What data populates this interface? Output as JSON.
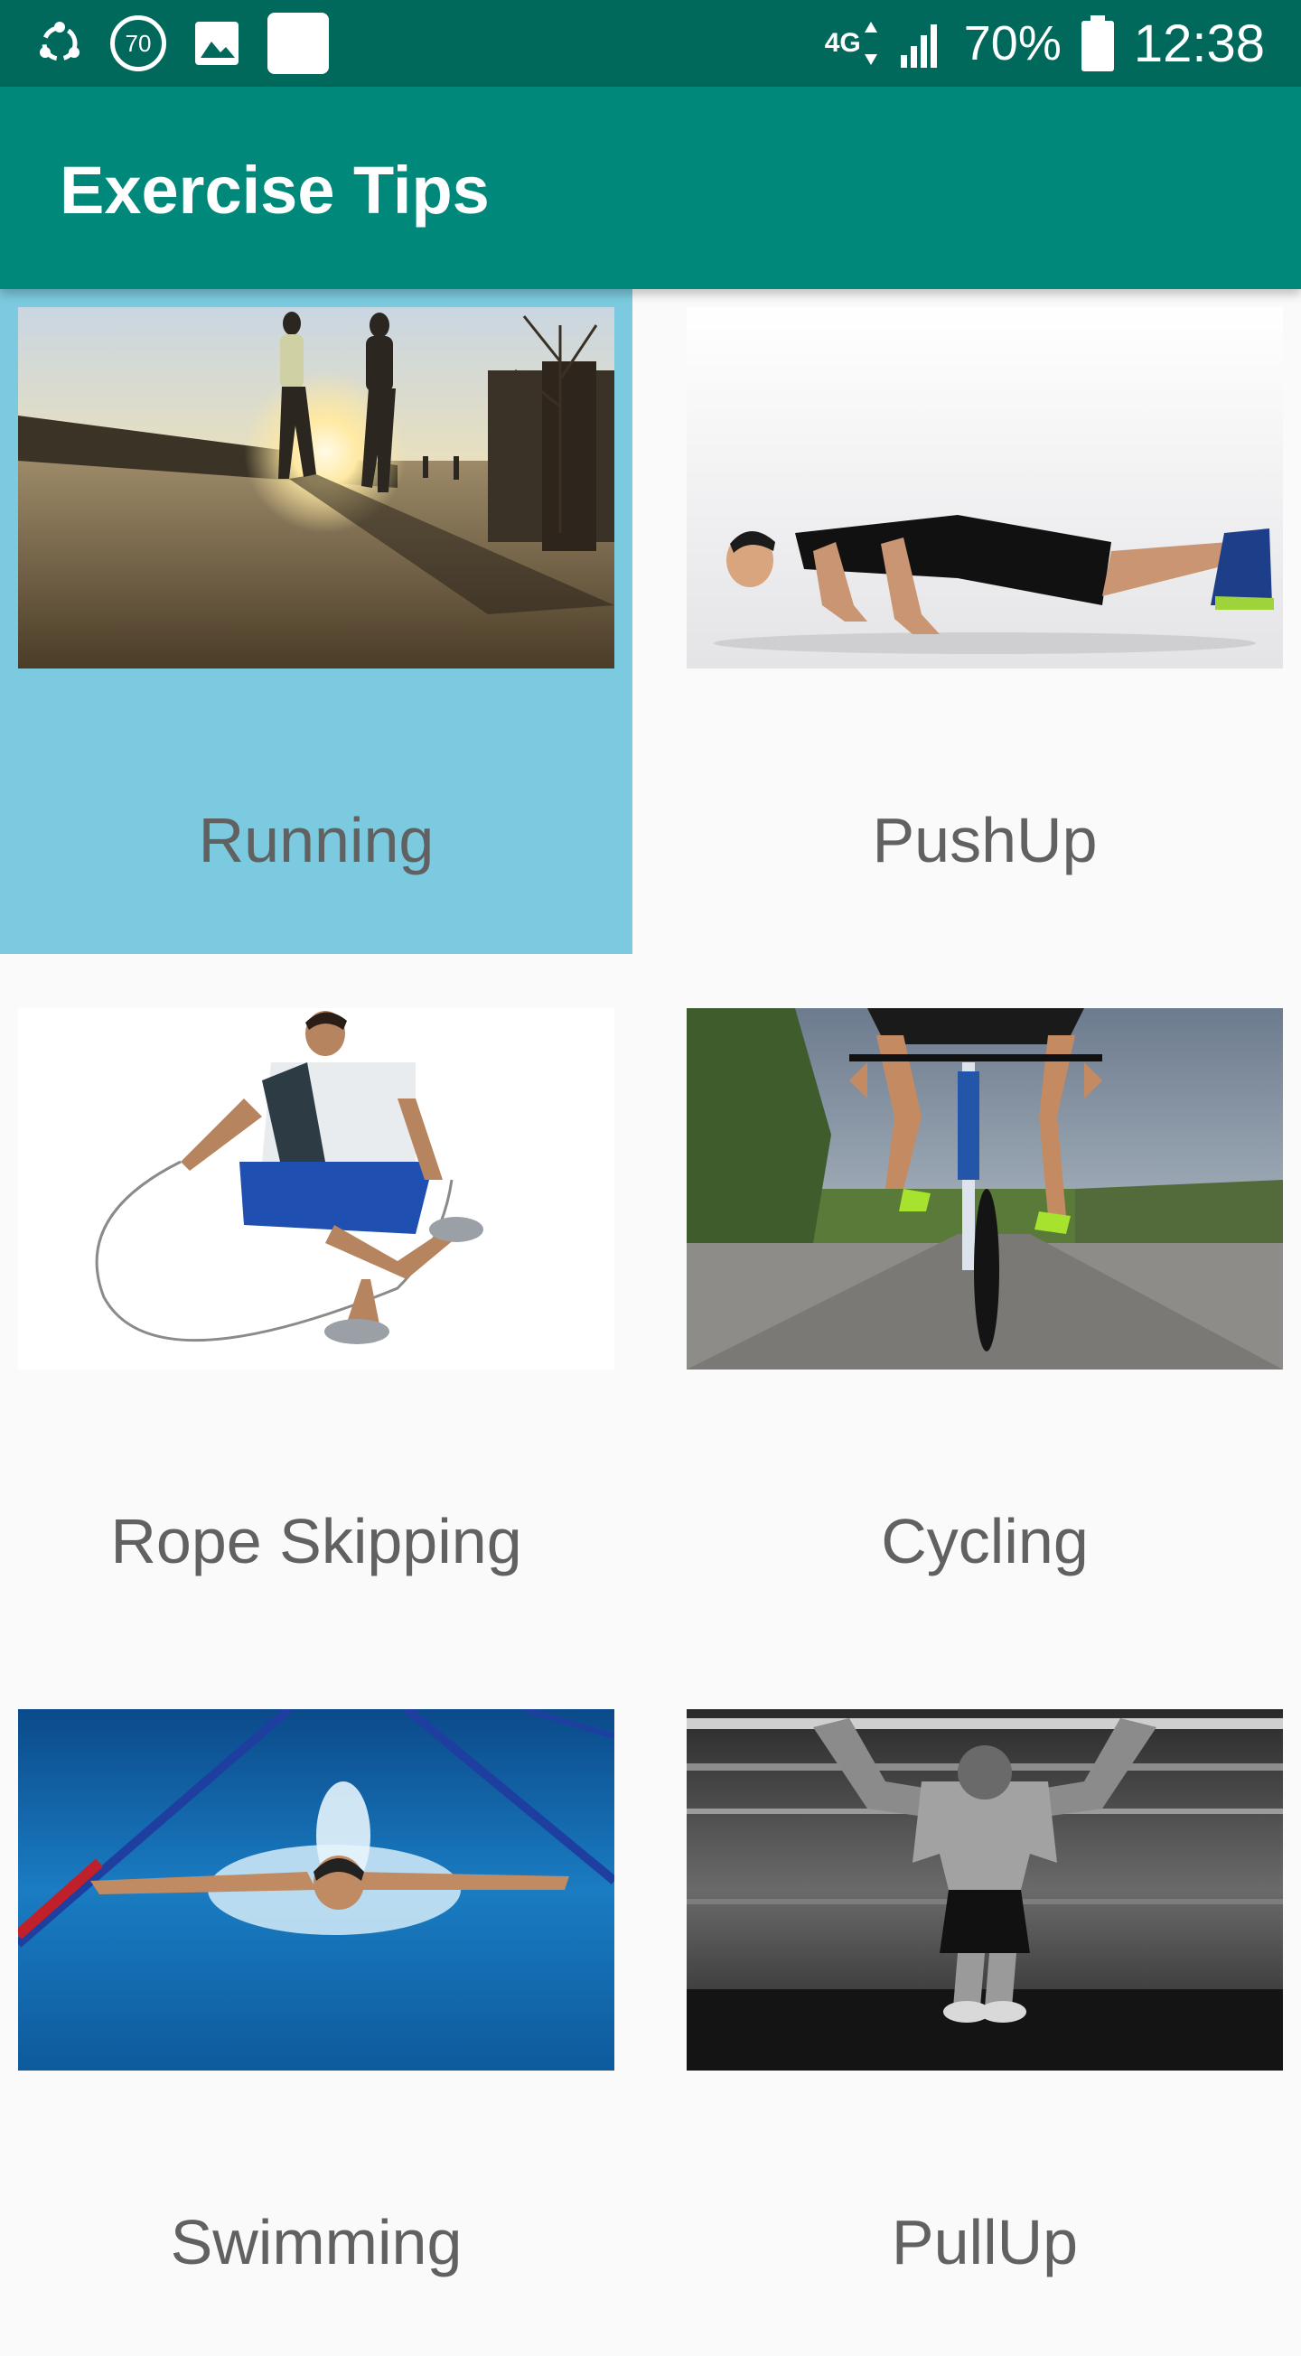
{
  "status_bar": {
    "badge_number": "70",
    "network_type": "4G",
    "battery": "70%",
    "time": "12:38"
  },
  "app_bar": {
    "title": "Exercise Tips"
  },
  "exercises": [
    {
      "label": "Running",
      "selected": true,
      "image": "runners-at-sunset"
    },
    {
      "label": "PushUp",
      "selected": false,
      "image": "man-doing-pushup"
    },
    {
      "label": "Rope Skipping",
      "selected": false,
      "image": "man-jumping-rope"
    },
    {
      "label": "Cycling",
      "selected": false,
      "image": "cyclist-on-road"
    },
    {
      "label": "Swimming",
      "selected": false,
      "image": "swimmer-butterfly-stroke"
    },
    {
      "label": "PullUp",
      "selected": false,
      "image": "man-doing-pullup"
    }
  ],
  "colors": {
    "status_bar": "#00695c",
    "app_bar": "#00897b",
    "selected_tile": "#7ccadf",
    "label_text": "#616161"
  }
}
